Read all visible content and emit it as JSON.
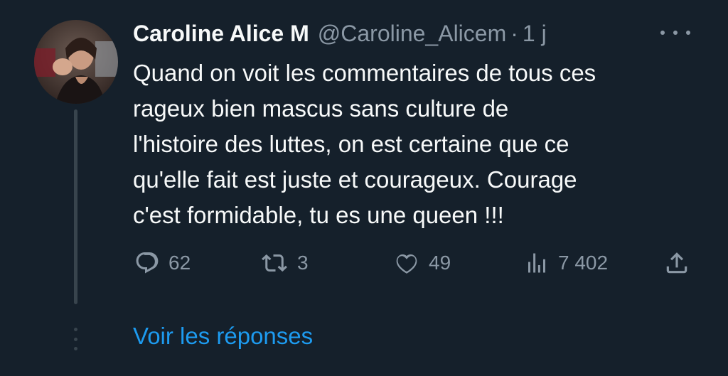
{
  "tweet": {
    "display_name": "Caroline Alice M",
    "handle": "@Caroline_Alicem",
    "separator": "·",
    "time": "1 j",
    "avatar_icon": "user-avatar-photo",
    "more_icon": "more-horizontal-icon",
    "text_lines": [
      "Quand on voit les commentaires de tous ces",
      "rageux bien mascus sans culture de",
      "l'histoire des luttes, on est certaine que ce",
      "qu'elle fait est juste et courageux. Courage",
      "c'est formidable, tu es une queen !!!"
    ]
  },
  "actions": {
    "reply": {
      "icon": "reply-icon",
      "count": "62"
    },
    "retweet": {
      "icon": "retweet-icon",
      "count": "3"
    },
    "like": {
      "icon": "heart-icon",
      "count": "49"
    },
    "views": {
      "icon": "analytics-icon",
      "count": "7 402"
    },
    "share": {
      "icon": "share-icon"
    }
  },
  "thread": {
    "show_replies_label": "Voir les réponses"
  },
  "colors": {
    "background": "#15202b",
    "text": "#f7f9f9",
    "muted": "#8b98a5",
    "link": "#1d9bf0",
    "thread_line": "#38444d"
  }
}
